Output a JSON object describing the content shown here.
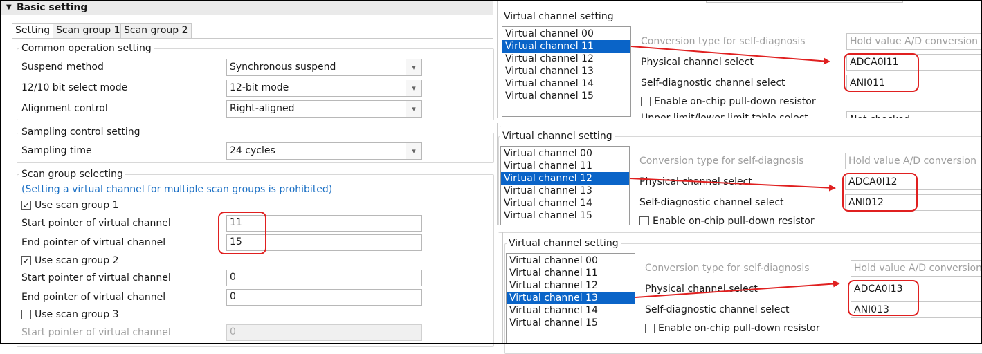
{
  "basic": {
    "header": "Basic setting",
    "tabs": [
      "Setting",
      "Scan group 1",
      "Scan group 2"
    ],
    "common": {
      "title": "Common operation setting",
      "suspend_label": "Suspend method",
      "suspend_value": "Synchronous suspend",
      "bitmode_label": "12/10 bit select mode",
      "bitmode_value": "12-bit mode",
      "align_label": "Alignment control",
      "align_value": "Right-aligned"
    },
    "sampling": {
      "title": "Sampling control setting",
      "time_label": "Sampling time",
      "time_value": "24 cycles"
    },
    "scan": {
      "title": "Scan group selecting",
      "note": "(Setting a virtual channel for multiple scan groups is prohibited)",
      "group1": {
        "label": "Use scan group 1",
        "checked": true,
        "start_label": "Start pointer of virtual channel",
        "start_value": "11",
        "end_label": "End pointer of virtual channel",
        "end_value": "15"
      },
      "group2": {
        "label": "Use scan group 2",
        "checked": true,
        "start_label": "Start pointer of virtual channel",
        "start_value": "0",
        "end_label": "End pointer of virtual channel",
        "end_value": "0"
      },
      "group3": {
        "label": "Use scan group 3",
        "checked": false,
        "start_label": "Start pointer of virtual channel",
        "start_value": "0"
      }
    }
  },
  "vpanels": [
    {
      "title": "Virtual channel setting",
      "channels": [
        "Virtual channel 00",
        "Virtual channel 11",
        "Virtual channel 12",
        "Virtual channel 13",
        "Virtual channel 14",
        "Virtual channel 15"
      ],
      "selected_index": 1,
      "conv_label": "Conversion type for self-diagnosis",
      "conv_value": "Hold value A/D conversion",
      "phys_label": "Physical channel select",
      "phys_value": "ADCA0I11",
      "diag_label": "Self-diagnostic channel select",
      "diag_value": "ANI011",
      "pulldown_label": "Enable on-chip pull-down resistor",
      "cut_label": "Upper limit/lower limit table select",
      "cut_value": "Not checked"
    },
    {
      "title": "Virtual channel setting",
      "channels": [
        "Virtual channel 00",
        "Virtual channel 11",
        "Virtual channel 12",
        "Virtual channel 13",
        "Virtual channel 14",
        "Virtual channel 15"
      ],
      "selected_index": 2,
      "conv_label": "Conversion type for self-diagnosis",
      "conv_value": "Hold value A/D conversion",
      "phys_label": "Physical channel select",
      "phys_value": "ADCA0I12",
      "diag_label": "Self-diagnostic channel select",
      "diag_value": "ANI012",
      "pulldown_label": "Enable on-chip pull-down resistor"
    },
    {
      "title": "Virtual channel setting",
      "channels": [
        "Virtual channel 00",
        "Virtual channel 11",
        "Virtual channel 12",
        "Virtual channel 13",
        "Virtual channel 14",
        "Virtual channel 15"
      ],
      "selected_index": 3,
      "conv_label": "Conversion type for self-diagnosis",
      "conv_value": "Hold value A/D conversion",
      "phys_label": "Physical channel select",
      "phys_value": "ADCA0I13",
      "diag_label": "Self-diagnostic channel select",
      "diag_value": "ANI013",
      "pulldown_label": "Enable on-chip pull-down resistor"
    }
  ],
  "icons": {
    "expand": "caret-down-icon",
    "dropdown": "chevron-down-icon",
    "check": "checkmark-icon"
  },
  "colors": {
    "selection": "#0a64c8",
    "annotation": "#e02020",
    "note_text": "#1a6fc4",
    "disabled_text": "#a0a0a0"
  }
}
